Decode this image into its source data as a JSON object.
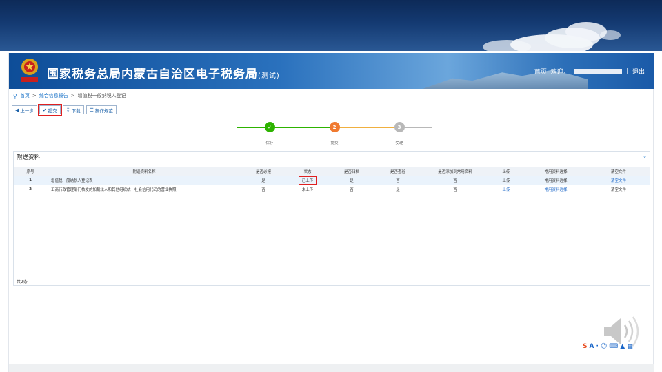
{
  "header": {
    "title": "国家税务总局内蒙古自治区电子税务局",
    "title_suffix": "(测试)",
    "home_label": "首页",
    "welcome_label": "欢迎，",
    "separator": "|",
    "logout_label": "退出"
  },
  "breadcrumb": {
    "home": "首页",
    "sep": ">",
    "section": "综合信息报告",
    "current": "增值税一般纳税人登记"
  },
  "toolbar": {
    "prev_label": "上一步",
    "submit_label": "提交",
    "download_label": "下载",
    "guide_label": "操作规范"
  },
  "steps": [
    {
      "label": "保存",
      "state": "done",
      "number": "✓"
    },
    {
      "label": "提交",
      "state": "current",
      "number": "2"
    },
    {
      "label": "受理",
      "state": "pending",
      "number": "3"
    }
  ],
  "section": {
    "title": "附送资料",
    "columns": [
      "序号",
      "附送资料名称",
      "是否必报",
      "状态",
      "是否归档",
      "是否查验",
      "是否添加到常用资料",
      "上传",
      "常用资料选择",
      "清空文件"
    ],
    "rows": [
      {
        "seq": "1",
        "name": "增值税一般纳税人登记表",
        "required": "是",
        "status": "已上传",
        "archived": "是",
        "verified": "否",
        "add_common": "否",
        "upload": "上传",
        "common_select": "常用资料选择",
        "clear": "清空文件"
      },
      {
        "seq": "2",
        "name": "工商行政管理部门核发的加载法人和其他组织统一社会信用代码的营业执照",
        "required": "否",
        "status": "未上传",
        "archived": "否",
        "verified": "是",
        "add_common": "否",
        "upload": "上传",
        "common_select": "常用资料选择",
        "clear": "清空文件"
      }
    ],
    "count": "共2条"
  },
  "colors": {
    "accent": "#1a73c8",
    "step_done": "#2db300",
    "step_current": "#f07a30",
    "step_pending": "#b8b8b8",
    "highlight": "#e02020"
  }
}
